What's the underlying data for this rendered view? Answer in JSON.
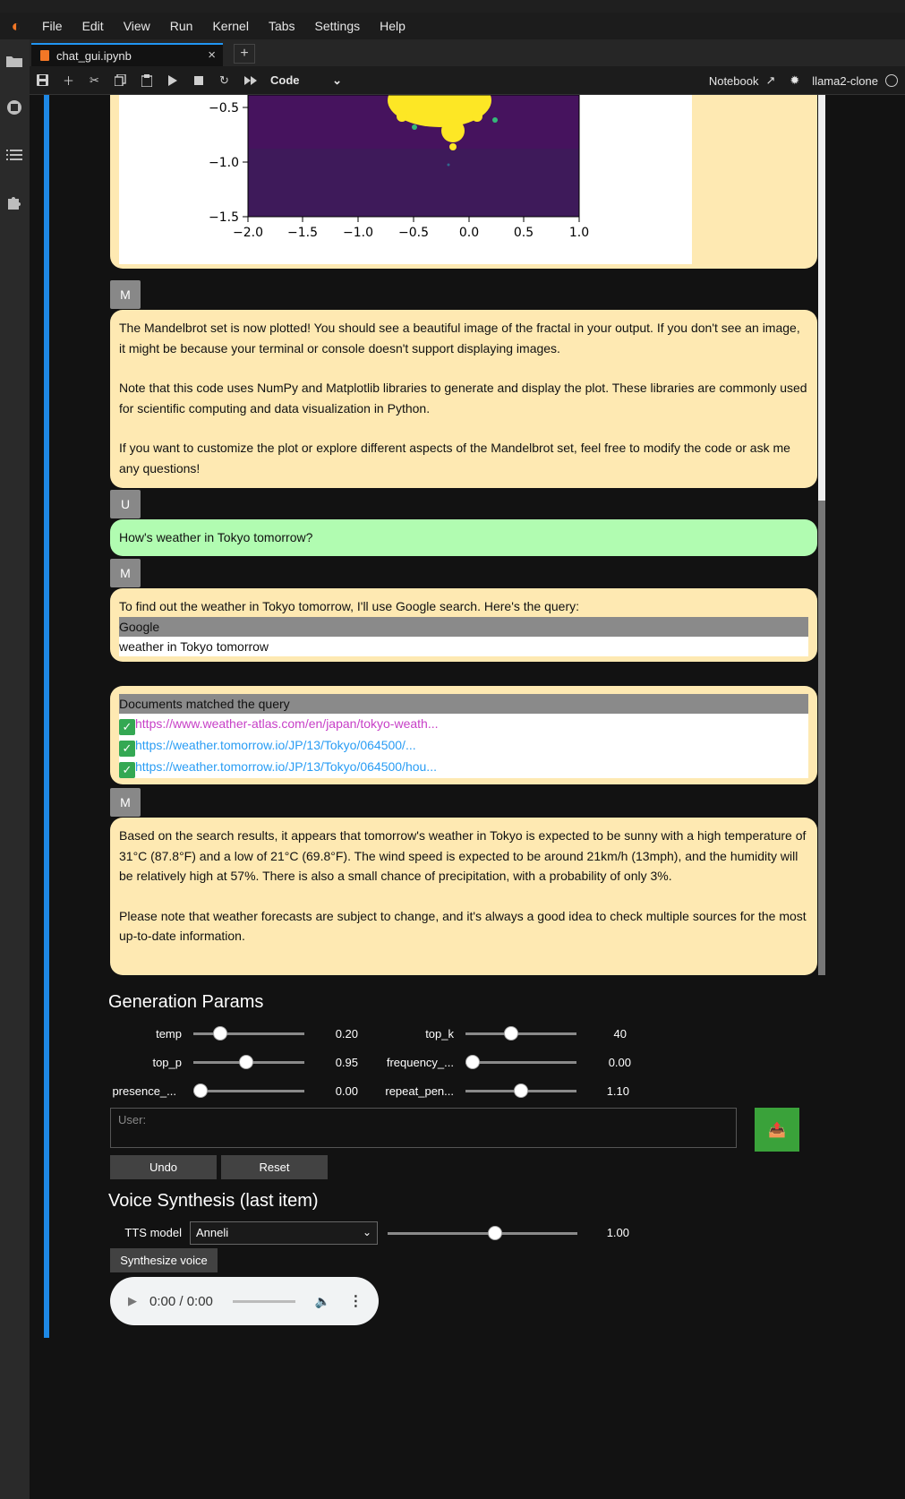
{
  "menu": [
    "File",
    "Edit",
    "View",
    "Run",
    "Kernel",
    "Tabs",
    "Settings",
    "Help"
  ],
  "tab": {
    "title": "chat_gui.ipynb",
    "close": "×",
    "add": "+"
  },
  "toolbar": {
    "cell_type": "Code",
    "notebook_label": "Notebook",
    "kernel_name": "llama2-clone"
  },
  "plot": {
    "yticks": [
      "−0.5",
      "−1.0",
      "−1.5"
    ],
    "xticks": [
      "−2.0",
      "−1.5",
      "−1.0",
      "−0.5",
      "0.0",
      "0.5",
      "1.0"
    ]
  },
  "chat": {
    "m_avatar": "M",
    "u_avatar": "U",
    "msg1_p1": "The Mandelbrot set is now plotted! You should see a beautiful image of the fractal in your output. If you don't see an image, it might be because your terminal or console doesn't support displaying images.",
    "msg1_p2": "Note that this code uses NumPy and Matplotlib libraries to generate and display the plot. These libraries are commonly used for scientific computing and data visualization in Python.",
    "msg1_p3": "If you want to customize the plot or explore different aspects of the Mandelbrot set, feel free to modify the code or ask me any questions!",
    "user_msg": "How's weather in Tokyo tomorrow?",
    "msg2_intro": "To find out the weather in Tokyo tomorrow, I'll use Google search. Here's the query:",
    "query_engine": "Google",
    "query_text": "weather in Tokyo tomorrow",
    "docs_header": "Documents matched the query",
    "check": "✓",
    "links": [
      "https://www.weather-atlas.com/en/japan/tokyo-weath...",
      "https://weather.tomorrow.io/JP/13/Tokyo/064500/...",
      "https://weather.tomorrow.io/JP/13/Tokyo/064500/hou..."
    ],
    "msg3_p1": "Based on the search results, it appears that tomorrow's weather in Tokyo is expected to be sunny with a high temperature of 31°C (87.8°F) and a low of 21°C (69.8°F). The wind speed is expected to be around 21km/h (13mph), and the humidity will be relatively high at 57%. There is also a small chance of precipitation, with a probability of only 3%.",
    "msg3_p2": "Please note that weather forecasts are subject to change, and it's always a good idea to check multiple sources for the most up-to-date information."
  },
  "params": {
    "title": "Generation Params",
    "temp": {
      "label": "temp",
      "value": "0.20",
      "level": 0.2
    },
    "top_k": {
      "label": "top_k",
      "value": "40",
      "level": 0.4
    },
    "top_p": {
      "label": "top_p",
      "value": "0.95",
      "level": 0.475
    },
    "frequency": {
      "label": "frequency_...",
      "value": "0.00",
      "level": 0.0
    },
    "presence": {
      "label": "presence_...",
      "value": "0.00",
      "level": 0.0
    },
    "repeat": {
      "label": "repeat_pen...",
      "value": "1.10",
      "level": 0.5
    }
  },
  "input": {
    "placeholder": "User:",
    "undo": "Undo",
    "reset": "Reset"
  },
  "voice": {
    "title": "Voice Synthesis (last item)",
    "tts_label": "TTS model",
    "tts_value": "Anneli",
    "speed_value": "1.00",
    "speed_level": 0.57,
    "synth_button": "Synthesize voice",
    "audio_time": "0:00 / 0:00"
  }
}
